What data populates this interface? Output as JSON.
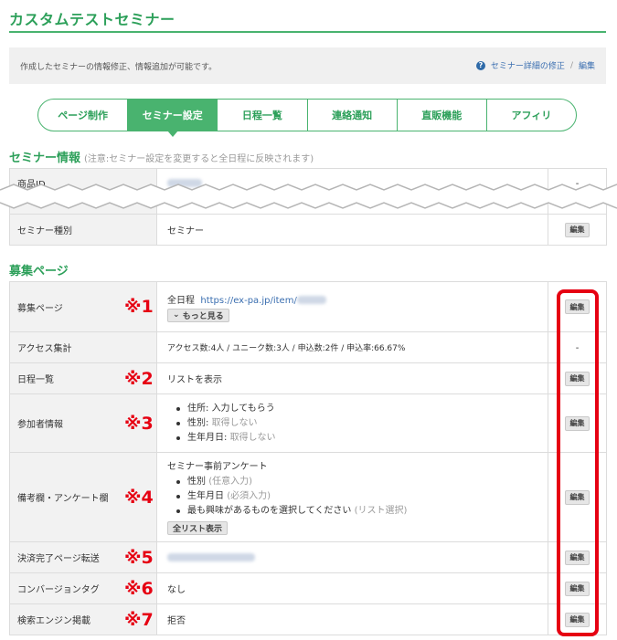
{
  "page": {
    "title": "カスタムテストセミナー"
  },
  "info_bar": {
    "text": "作成したセミナーの情報修正、情報追加が可能です。",
    "help_icon": "question-circle-icon",
    "link_label": "セミナー詳細の修正",
    "separator": "/",
    "edit_label": "編集"
  },
  "tabs": [
    {
      "label": "ページ制作",
      "active": false
    },
    {
      "label": "セミナー設定",
      "active": true
    },
    {
      "label": "日程一覧",
      "active": false
    },
    {
      "label": "連絡通知",
      "active": false
    },
    {
      "label": "直販機能",
      "active": false
    },
    {
      "label": "アフィリ",
      "active": false
    }
  ],
  "seminar_info": {
    "title": "セミナー情報",
    "note": "(注意:セミナー設定を変更すると全日程に反映されます)",
    "rows": [
      {
        "label": "商品ID",
        "action": "-"
      },
      {
        "label": "セミナー種別",
        "value": "セミナー",
        "action": "編集"
      }
    ]
  },
  "recruit": {
    "title": "募集ページ",
    "edit_label": "編集",
    "dash": "-",
    "rows": {
      "recruit_page": {
        "label": "募集ページ",
        "mark": "※1",
        "prefix": "全日程",
        "url": "https://ex-pa.jp/item/",
        "more_btn": "もっと見る"
      },
      "access": {
        "label": "アクセス集計",
        "value": "アクセス数:4人 / ユニーク数:3人 / 申込数:2件 / 申込率:66.67%"
      },
      "schedule": {
        "label": "日程一覧",
        "mark": "※2",
        "value": "リストを表示"
      },
      "participant": {
        "label": "参加者情報",
        "mark": "※3",
        "items": [
          {
            "name": "住所:",
            "status": "入力してもらう",
            "muted": false
          },
          {
            "name": "性別:",
            "status": "取得しない",
            "muted": true
          },
          {
            "name": "生年月日:",
            "status": "取得しない",
            "muted": true
          }
        ]
      },
      "remarks": {
        "label": "備考欄・アンケート欄",
        "mark": "※4",
        "heading": "セミナー事前アンケート",
        "items": [
          {
            "name": "性別",
            "note": "(任意入力)"
          },
          {
            "name": "生年月日",
            "note": "(必須入力)"
          },
          {
            "name": "最も興味があるものを選択してください",
            "note": "(リスト選択)"
          }
        ],
        "all_btn": "全リスト表示"
      },
      "payment": {
        "label": "決済完了ページ転送",
        "mark": "※5"
      },
      "conversion": {
        "label": "コンバージョンタグ",
        "mark": "※6",
        "value": "なし"
      },
      "search": {
        "label": "検索エンジン掲載",
        "mark": "※7",
        "value": "拒否"
      }
    }
  },
  "colors": {
    "brand": "#49b36f",
    "brand_text": "#2da05a",
    "highlight": "#e60012",
    "link": "#3a6eb0"
  }
}
